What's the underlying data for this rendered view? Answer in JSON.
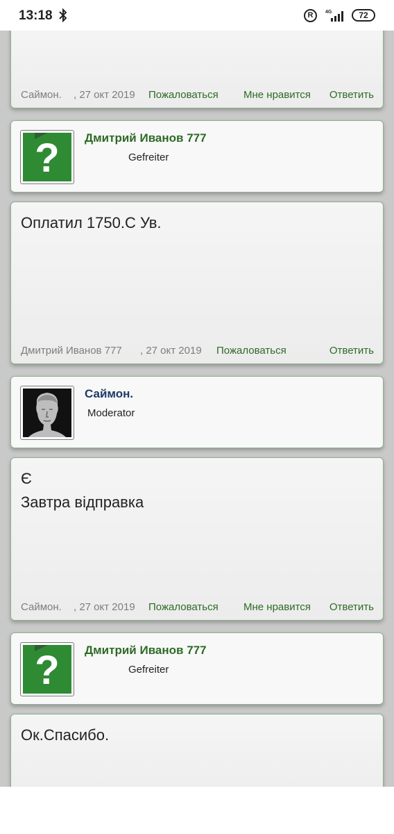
{
  "status": {
    "time": "13:18",
    "network": "4G",
    "battery": "72",
    "reg_mark": "R"
  },
  "posts": [
    {
      "meta": {
        "author": "Саймон.",
        "date": ", 27 окт 2019",
        "report": "Пожаловаться",
        "like": "Мне нравится",
        "reply": "Ответить"
      }
    },
    {
      "user": {
        "name": "Дмитрий Иванов 777",
        "rank": "Gefreiter",
        "avatar_icon": "question-mark-icon"
      }
    },
    {
      "text": "Оплатил 1750.С Ув.",
      "meta": {
        "author": "Дмитрий Иванов 777",
        "date": ", 27 окт 2019",
        "report": "Пожаловаться",
        "reply": "Ответить"
      }
    },
    {
      "user": {
        "name": "Саймон.",
        "rank": "Moderator",
        "avatar_icon": "statue-avatar-icon"
      }
    },
    {
      "text_line1": "Є",
      "text_line2": "Завтра відправка",
      "meta": {
        "author": "Саймон.",
        "date": ", 27 окт 2019",
        "report": "Пожаловаться",
        "like": "Мне нравится",
        "reply": "Ответить"
      }
    },
    {
      "user": {
        "name": "Дмитрий Иванов 777",
        "rank": "Gefreiter",
        "avatar_icon": "question-mark-icon"
      }
    },
    {
      "text": "Ок.Спасибо."
    }
  ],
  "colors": {
    "accent": "#2e6a26",
    "moderator": "#1f3a66",
    "background": "#c9c9c9"
  }
}
